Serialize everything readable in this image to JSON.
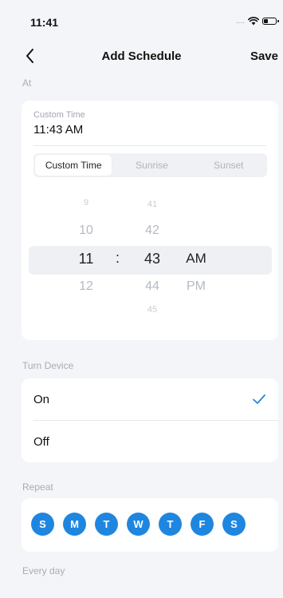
{
  "status_bar": {
    "time": "11:41",
    "signal": "....",
    "battery_level": 0.3
  },
  "nav": {
    "title": "Add Schedule",
    "save_label": "Save"
  },
  "at_section": {
    "label": "At",
    "custom_time_label": "Custom Time",
    "custom_time_value": "11:43 AM",
    "modes": [
      "Custom Time",
      "Sunrise",
      "Sunset"
    ],
    "active_mode": "Custom Time"
  },
  "picker": {
    "hours": [
      "9",
      "10",
      "11",
      "12"
    ],
    "minutes": [
      "41",
      "42",
      "43",
      "44",
      "45"
    ],
    "separator": ":",
    "ampm": [
      "AM",
      "PM"
    ],
    "selected": {
      "hour": "11",
      "minute": "43",
      "ampm": "AM"
    }
  },
  "turn_device": {
    "label": "Turn Device",
    "options": [
      {
        "label": "On",
        "checked": true
      },
      {
        "label": "Off",
        "checked": false
      }
    ]
  },
  "repeat": {
    "label": "Repeat",
    "days": [
      "S",
      "M",
      "T",
      "W",
      "T",
      "F",
      "S"
    ],
    "summary": "Every day"
  },
  "colors": {
    "accent": "#1f86e0",
    "background": "#f4f5f8",
    "card": "#ffffff"
  }
}
